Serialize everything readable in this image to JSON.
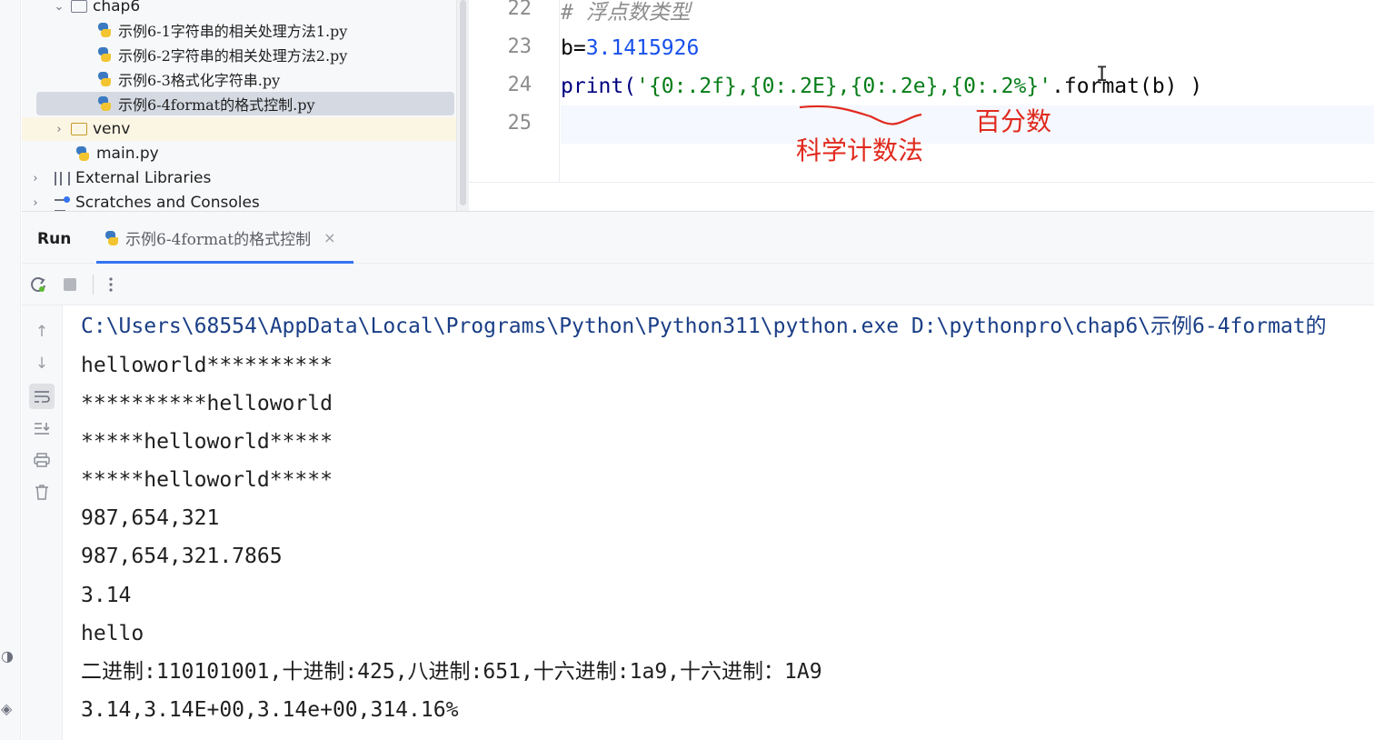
{
  "project_tree": {
    "folder_chap6": "chap6",
    "files": [
      "示例6-1字符串的相关处理方法1.py",
      "示例6-2字符串的相关处理方法2.py",
      "示例6-3格式化字符串.py",
      "示例6-4format的格式控制.py"
    ],
    "venv": "venv",
    "main_file": "main.py",
    "external_libraries": "External Libraries",
    "scratches": "Scratches and Consoles"
  },
  "editor": {
    "line_numbers": [
      "22",
      "23",
      "24",
      "25"
    ],
    "line22_comment": "# 浮点数类型",
    "line23_var": "b=",
    "line23_num": "3.1415926",
    "line24_fn": "print(",
    "line24_str": "'{0:.2f},{0:.2E},{0:.2e},{0:.2%}'",
    "line24_rest": ".format(b) )",
    "annotation_percent": "百分数",
    "annotation_sci": "科学计数法",
    "cursor_glyph": "I"
  },
  "run_panel": {
    "title": "Run",
    "tab_label": "示例6-4format的格式控制",
    "tab_close": "×"
  },
  "console": {
    "lines": [
      "C:\\Users\\68554\\AppData\\Local\\Programs\\Python\\Python311\\python.exe D:\\pythonpro\\chap6\\示例6-4format的",
      "helloworld**********",
      "**********helloworld",
      "*****helloworld*****",
      "*****helloworld*****",
      "987,654,321",
      "987,654,321.7865",
      "3.14",
      "hello",
      "二进制:110101001,十进制:425,八进制:651,十六进制:1a9,十六进制：1A9",
      "3.14,3.14E+00,3.14e+00,314.16%"
    ]
  },
  "colors": {
    "annotation": "#e02a1e",
    "accent": "#3574f0",
    "string": "#067d17",
    "number": "#1750eb"
  }
}
